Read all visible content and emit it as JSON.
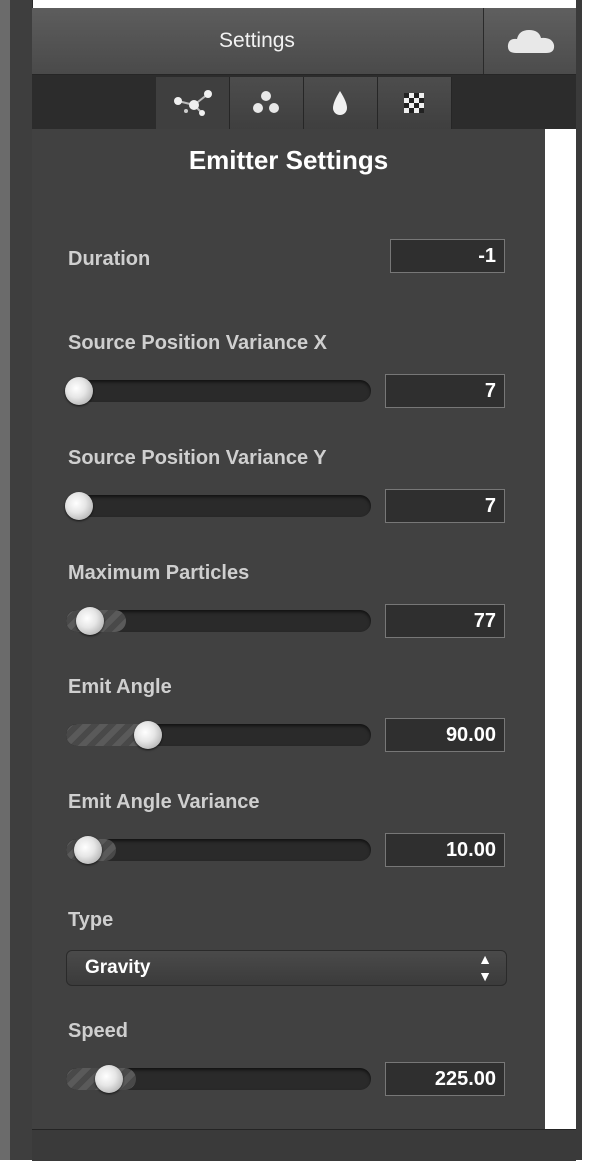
{
  "window": {
    "title": "Settings"
  },
  "header": {
    "cloud_icon": "cloud-icon"
  },
  "tabs": [
    {
      "icon": "particles-icon",
      "active": true
    },
    {
      "icon": "molecule-icon",
      "active": false
    },
    {
      "icon": "drop-icon",
      "active": false
    },
    {
      "icon": "checkerboard-icon",
      "active": false
    }
  ],
  "panel": {
    "heading": "Emitter Settings",
    "duration": {
      "label": "Duration",
      "value": "-1"
    },
    "source_x": {
      "label": "Source Position Variance X",
      "value": "7",
      "level": 0.02
    },
    "source_y": {
      "label": "Source Position Variance Y",
      "value": "7",
      "level": 0.02
    },
    "max_particles": {
      "label": "Maximum Particles",
      "value": "77",
      "level": 0.08
    },
    "emit_angle": {
      "label": "Emit Angle",
      "value": "90.00",
      "level": 0.25
    },
    "emit_angle_var": {
      "label": "Emit Angle Variance",
      "value": "10.00",
      "level": 0.06
    },
    "type": {
      "label": "Type",
      "value": "Gravity"
    },
    "speed": {
      "label": "Speed",
      "value": "225.00",
      "level": 0.15
    }
  },
  "colors": {
    "panel": "#414141",
    "header": "#4f4f4f",
    "text": "#cfcfcf"
  }
}
